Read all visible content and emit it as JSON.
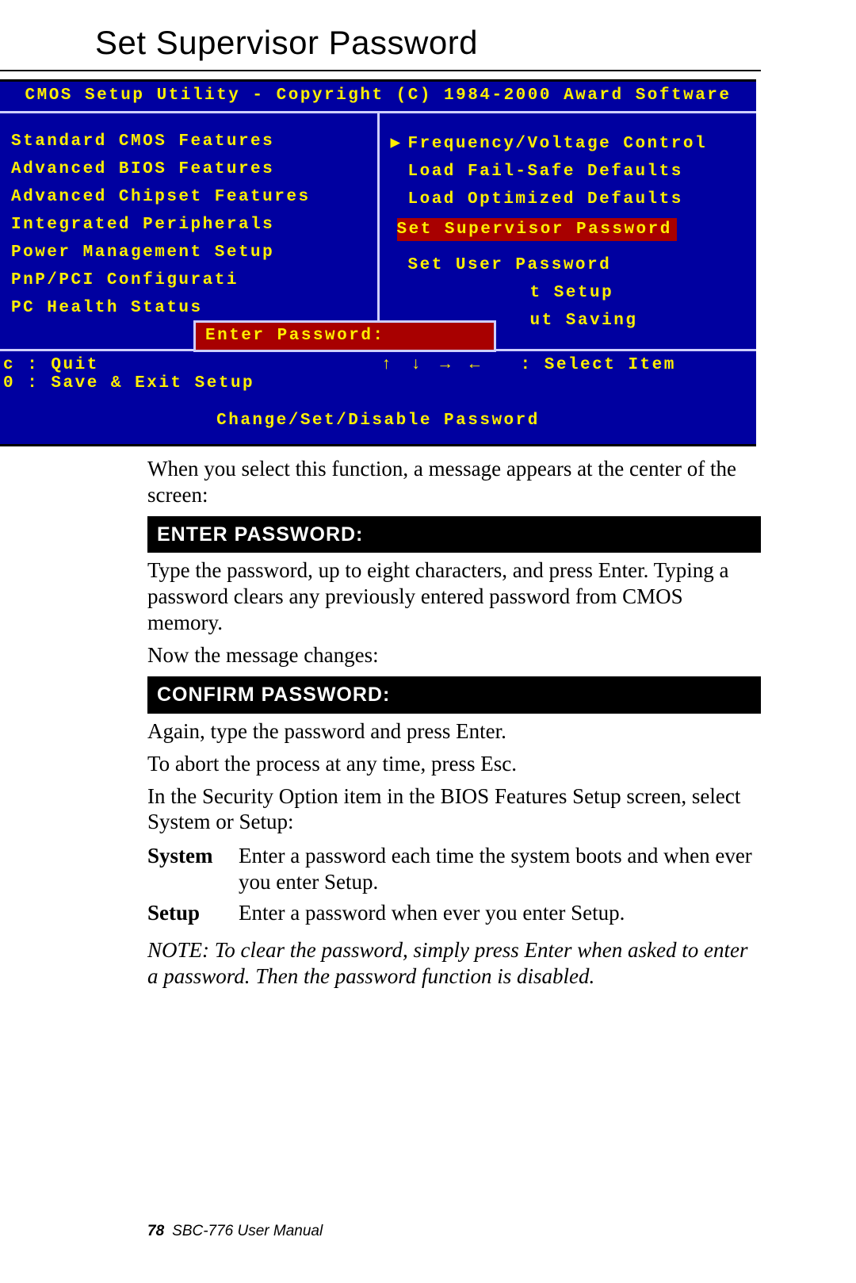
{
  "title": "Set Supervisor Password",
  "bios": {
    "header": "CMOS Setup Utility - Copyright (C) 1984-2000 Award Software",
    "left_menu": [
      "Standard CMOS Features",
      "Advanced BIOS Features",
      "Advanced Chipset Features",
      "Integrated Peripherals",
      "Power Management Setup",
      "PnP/PCI Configurati",
      "PC Health Status"
    ],
    "right_menu": [
      {
        "label": "Frequency/Voltage Control",
        "arrow": true
      },
      {
        "label": "Load Fail-Safe Defaults",
        "arrow": false
      },
      {
        "label": "Load Optimized Defaults",
        "arrow": false
      },
      {
        "label": "Set Supervisor Password",
        "arrow": false,
        "selected": true
      },
      {
        "label": "Set User Password",
        "arrow": false
      },
      {
        "label": "t Setup",
        "arrow": false,
        "partial_left": true
      },
      {
        "label": "ut Saving",
        "arrow": false,
        "partial_left": true
      }
    ],
    "dialog": "Enter Password:",
    "footer_left": [
      "c : Quit",
      "0 : Save & Exit Setup"
    ],
    "footer_right_arrows": "↑ ↓ → ←",
    "footer_right_label": ": Select Item",
    "footer2": "Change/Set/Disable Password"
  },
  "text": {
    "p1": "When you select this function, a message appears at the center of the screen:",
    "bar1": "ENTER PASSWORD:",
    "p2": "Type the password, up to eight characters, and press Enter. Typing a password clears any previously entered password from CMOS memory.",
    "p3": "Now the message changes:",
    "bar2": "CONFIRM PASSWORD:",
    "p4": "Again, type the password and press Enter.",
    "p5": "To abort the process at any time, press Esc.",
    "p6": "In the Security Option item in the BIOS Features Setup screen, select System or Setup:",
    "defs": [
      {
        "term": "System",
        "desc": "Enter a password each time the system boots and when ever you enter Setup."
      },
      {
        "term": "Setup",
        "desc": "Enter a password when ever you enter Setup."
      }
    ],
    "note": "NOTE: To clear the password, simply press Enter when asked to enter a password. Then the password function is disabled."
  },
  "footer": {
    "page": "78",
    "manual": "SBC-776 User Manual"
  }
}
